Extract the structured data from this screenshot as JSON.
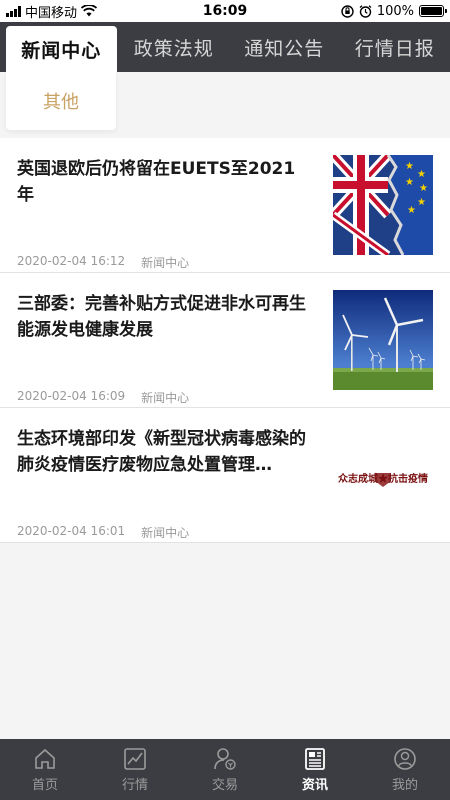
{
  "status_bar": {
    "carrier": "中国移动",
    "time": "16:09",
    "battery": "100%"
  },
  "tabs": [
    {
      "label": "新闻中心",
      "active": true
    },
    {
      "label": "政策法规",
      "active": false
    },
    {
      "label": "通知公告",
      "active": false
    },
    {
      "label": "行情日报",
      "active": false
    }
  ],
  "subtabs": [
    {
      "label": "其他"
    }
  ],
  "news": [
    {
      "title": "英国退欧后仍将留在EUETS至2021年",
      "date": "2020-02-04 16:12",
      "source": "新闻中心",
      "thumb": "uk-eu-flag"
    },
    {
      "title": "三部委：完善补贴方式促进非水可再生能源发电健康发展",
      "date": "2020-02-04 16:09",
      "source": "新闻中心",
      "thumb": "wind-turbines"
    },
    {
      "title": "生态环境部印发《新型冠状病毒感染的肺炎疫情医疗废物应急处置管理…",
      "date": "2020-02-04 16:01",
      "source": "新闻中心",
      "thumb": "anti-epidemic-banner",
      "thumb_text": "众志成城★抗击疫情"
    }
  ],
  "bottom_nav": [
    {
      "label": "首页",
      "icon": "home-icon",
      "active": false
    },
    {
      "label": "行情",
      "icon": "chart-icon",
      "active": false
    },
    {
      "label": "交易",
      "icon": "trade-icon",
      "active": false
    },
    {
      "label": "资讯",
      "icon": "news-icon",
      "active": true
    },
    {
      "label": "我的",
      "icon": "profile-icon",
      "active": false
    }
  ],
  "colors": {
    "dark_bar": "#3b3d42",
    "accent_gold": "#c9a163"
  }
}
